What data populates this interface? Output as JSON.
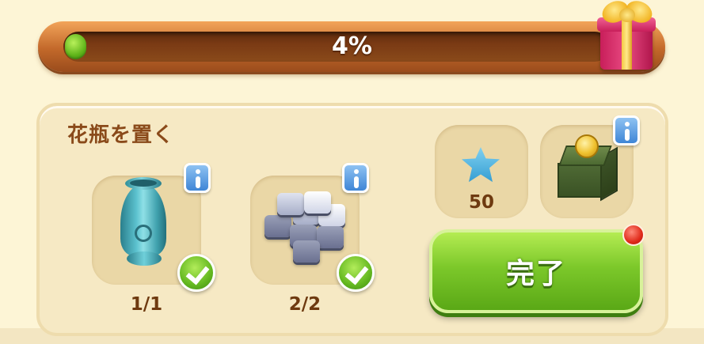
{
  "progress": {
    "percent_label": "4%",
    "fraction": 0.04
  },
  "reward": {
    "icon": "gift-box-icon"
  },
  "task": {
    "title": "花瓶を置く",
    "items": [
      {
        "name": "vase",
        "icon": "vase-icon",
        "count": "1/1",
        "completed": true
      },
      {
        "name": "stone-tiles",
        "icon": "stone-tiles-icon",
        "count": "2/2",
        "completed": true
      }
    ]
  },
  "rewards": [
    {
      "icon": "blue-star-icon",
      "amount": "50"
    },
    {
      "icon": "coin-chest-icon"
    }
  ],
  "done_button": {
    "label": "完了"
  },
  "colors": {
    "progress_fill": "#64b820",
    "button_green": "#7cc82a",
    "info_blue": "#3f86d6",
    "title_brown": "#8a4a1a"
  }
}
